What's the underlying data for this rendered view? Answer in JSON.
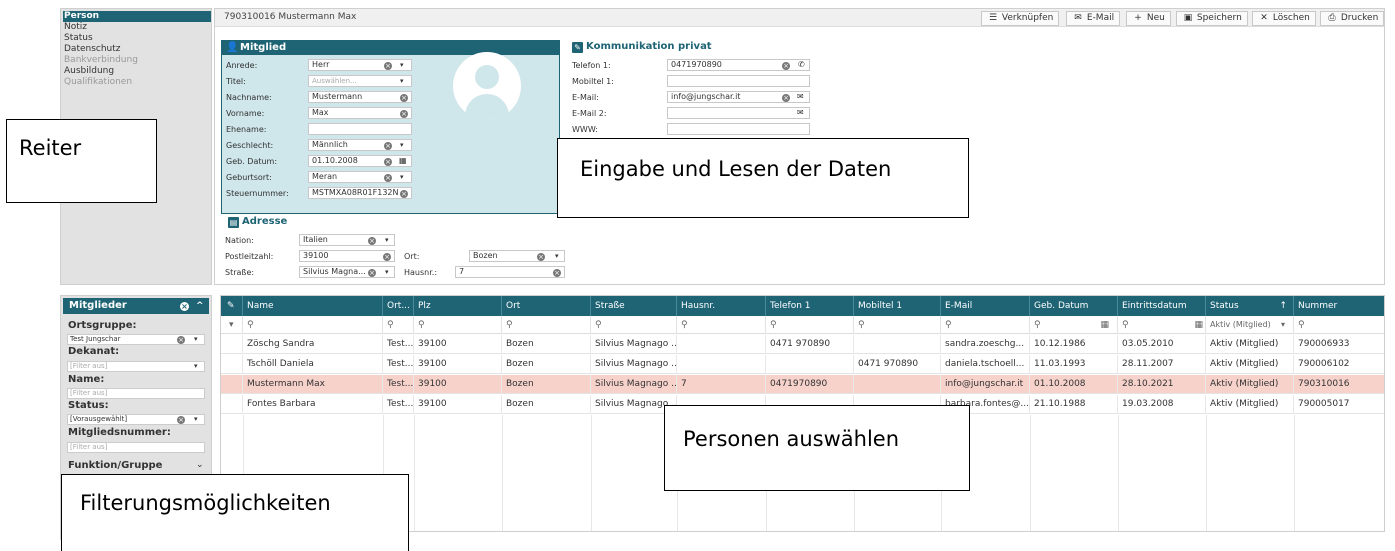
{
  "nav": {
    "items": [
      {
        "label": "Person",
        "state": "active"
      },
      {
        "label": "Notiz",
        "state": "normal"
      },
      {
        "label": "Status",
        "state": "normal"
      },
      {
        "label": "Datenschutz",
        "state": "normal"
      },
      {
        "label": "Bankverbindung",
        "state": "disabled"
      },
      {
        "label": "Ausbildung",
        "state": "normal"
      },
      {
        "label": "Qualifikationen",
        "state": "disabled"
      }
    ]
  },
  "record": {
    "title": "790310016 Mustermann Max"
  },
  "toolbar": {
    "verknuepfen": "Verknüpfen",
    "email": "E-Mail",
    "neu": "Neu",
    "speichern": "Speichern",
    "loeschen": "Löschen",
    "drucken": "Drucken"
  },
  "mitglied": {
    "title": "Mitglied",
    "anrede": {
      "label": "Anrede:",
      "value": "Herr"
    },
    "titel": {
      "label": "Titel:",
      "placeholder": "Auswählen..."
    },
    "nachname": {
      "label": "Nachname:",
      "value": "Mustermann"
    },
    "vorname": {
      "label": "Vorname:",
      "value": "Max"
    },
    "ehename": {
      "label": "Ehename:",
      "value": ""
    },
    "geschlecht": {
      "label": "Geschlecht:",
      "value": "Männlich"
    },
    "geb_datum": {
      "label": "Geb. Datum:",
      "value": "01.10.2008"
    },
    "geburtsort": {
      "label": "Geburtsort:",
      "value": "Meran"
    },
    "steuernummer": {
      "label": "Steuernummer:",
      "value": "MSTMXA08R01F132N"
    }
  },
  "kommunikation": {
    "title": "Kommunikation privat",
    "telefon1": {
      "label": "Telefon 1:",
      "value": "0471970890"
    },
    "mobiltel1": {
      "label": "Mobiltel 1:",
      "value": ""
    },
    "email": {
      "label": "E-Mail:",
      "value": "info@jungschar.it"
    },
    "email2": {
      "label": "E-Mail 2:",
      "value": ""
    },
    "www": {
      "label": "WWW:",
      "value": ""
    }
  },
  "adresse": {
    "title": "Adresse",
    "nation": {
      "label": "Nation:",
      "value": "Italien"
    },
    "plz": {
      "label": "Postleitzahl:",
      "value": "39100"
    },
    "ort": {
      "label": "Ort:",
      "value": "Bozen"
    },
    "strasse": {
      "label": "Straße:",
      "value": "Silvius Magna..."
    },
    "hausnr": {
      "label": "Hausnr.:",
      "value": "7"
    }
  },
  "filters": {
    "title": "Mitglieder",
    "ortsgruppe": {
      "label": "Ortsgruppe:",
      "value": "Test Jungschar"
    },
    "dekanat": {
      "label": "Dekanat:",
      "placeholder": "[Filter aus]"
    },
    "name": {
      "label": "Name:",
      "placeholder": "[Filter aus]"
    },
    "status": {
      "label": "Status:",
      "value": "[Vorausgewählt]"
    },
    "mitgliedsnummer": {
      "label": "Mitgliedsnummer:",
      "placeholder": "[Filter aus]"
    },
    "funktion": {
      "label": "Funktion/Gruppe"
    }
  },
  "grid": {
    "columns": [
      "Name",
      "Ort...",
      "Plz",
      "Ort",
      "Straße",
      "Hausnr.",
      "Telefon 1",
      "Mobiltel 1",
      "E-Mail",
      "Geb. Datum",
      "Eintrittsdatum",
      "Status",
      "Nummer"
    ],
    "status_filter": "Aktiv (Mitglied)",
    "rows": [
      {
        "name": "Zöschg Sandra",
        "ortsgruppe": "Test...",
        "plz": "39100",
        "ort": "Bozen",
        "strasse": "Silvius Magnago ...",
        "hausnr": "",
        "telefon": "0471 970890",
        "mobil": "",
        "email": "sandra.zoeschg...",
        "geb": "10.12.1986",
        "eintritt": "03.05.2010",
        "status": "Aktiv (Mitglied)",
        "nummer": "790006933",
        "selected": false
      },
      {
        "name": "Tschöll Daniela",
        "ortsgruppe": "Test...",
        "plz": "39100",
        "ort": "Bozen",
        "strasse": "Silvius Magnago ...",
        "hausnr": "",
        "telefon": "",
        "mobil": "0471 970890",
        "email": "daniela.tschoell...",
        "geb": "11.03.1993",
        "eintritt": "28.11.2007",
        "status": "Aktiv (Mitglied)",
        "nummer": "790006102",
        "selected": false
      },
      {
        "name": "Mustermann Max",
        "ortsgruppe": "Test...",
        "plz": "39100",
        "ort": "Bozen",
        "strasse": "Silvius Magnago ...",
        "hausnr": "7",
        "telefon": "0471970890",
        "mobil": "",
        "email": "info@jungschar.it",
        "geb": "01.10.2008",
        "eintritt": "28.10.2021",
        "status": "Aktiv (Mitglied)",
        "nummer": "790310016",
        "selected": true
      },
      {
        "name": "Fontes Barbara",
        "ortsgruppe": "Test...",
        "plz": "39100",
        "ort": "Bozen",
        "strasse": "Silvius Magnago ...",
        "hausnr": "",
        "telefon": "",
        "mobil": "",
        "email": "barbara.fontes@...",
        "geb": "21.10.1988",
        "eintritt": "19.03.2008",
        "status": "Aktiv (Mitglied)",
        "nummer": "790005017",
        "selected": false
      }
    ]
  },
  "callouts": {
    "reiter": "Reiter",
    "eingabe": "Eingabe und Lesen der Daten",
    "personen": "Personen auswählen",
    "filter": "Filterungsmöglichkeiten"
  },
  "colors": {
    "accent": "#1e6475",
    "selected_row": "#f6d2cb",
    "panel_bg": "#cfe6ea"
  }
}
